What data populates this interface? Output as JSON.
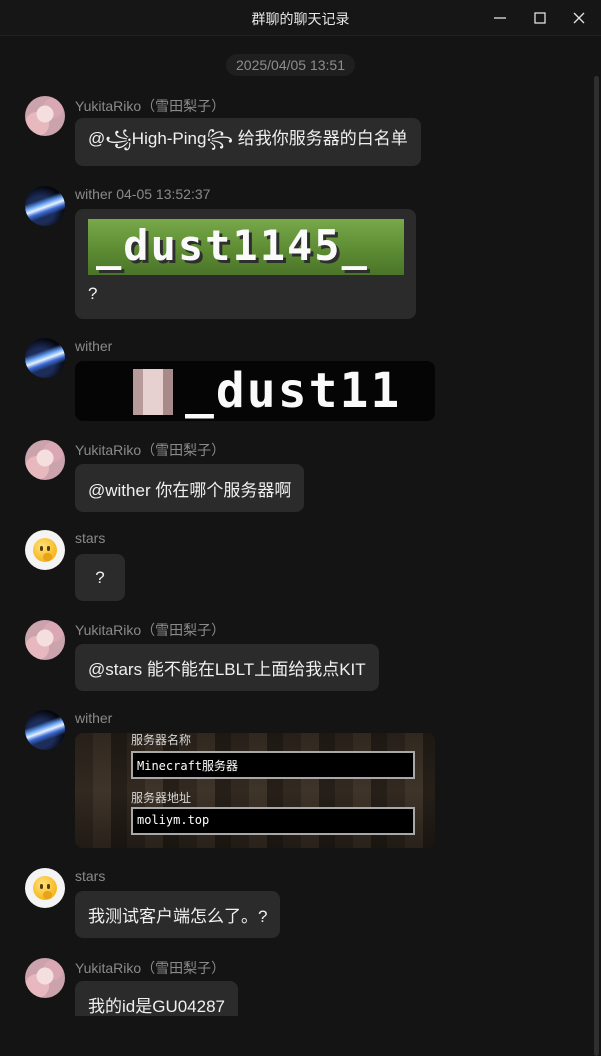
{
  "window": {
    "title": "群聊的聊天记录",
    "minimize_icon": "minimize-icon",
    "maximize_icon": "maximize-icon",
    "close_icon": "close-icon"
  },
  "timestamp": "2025/04/05 13:51",
  "messages": [
    {
      "sender": "YukitaRiko（雪田梨子）",
      "text": "@꧁High-Ping꧂ 给我你服务器的白名单"
    },
    {
      "sender": "wither 04-05 13:52:37",
      "image_text": "_dust1145_",
      "text": "?"
    },
    {
      "sender": "wither",
      "image_text": "_dust11"
    },
    {
      "sender": "YukitaRiko（雪田梨子）",
      "text": "@wither 你在哪个服务器啊"
    },
    {
      "sender": "stars",
      "text": "?"
    },
    {
      "sender": "YukitaRiko（雪田梨子）",
      "text": "@stars 能不能在LBLT上面给我点KIT"
    },
    {
      "sender": "wither",
      "image": {
        "name_label": "服务器名称",
        "name_value": "Minecraft服务器",
        "addr_label": "服务器地址",
        "addr_value": "moliym.top"
      }
    },
    {
      "sender": "stars",
      "text": "我测试客户端怎么了。?"
    },
    {
      "sender": "YukitaRiko（雪田梨子）",
      "text": "我的id是GU04287"
    }
  ],
  "colors": {
    "background": "#141414",
    "bubble": "#2b2b2b",
    "sender_text": "#8a8a8a"
  }
}
